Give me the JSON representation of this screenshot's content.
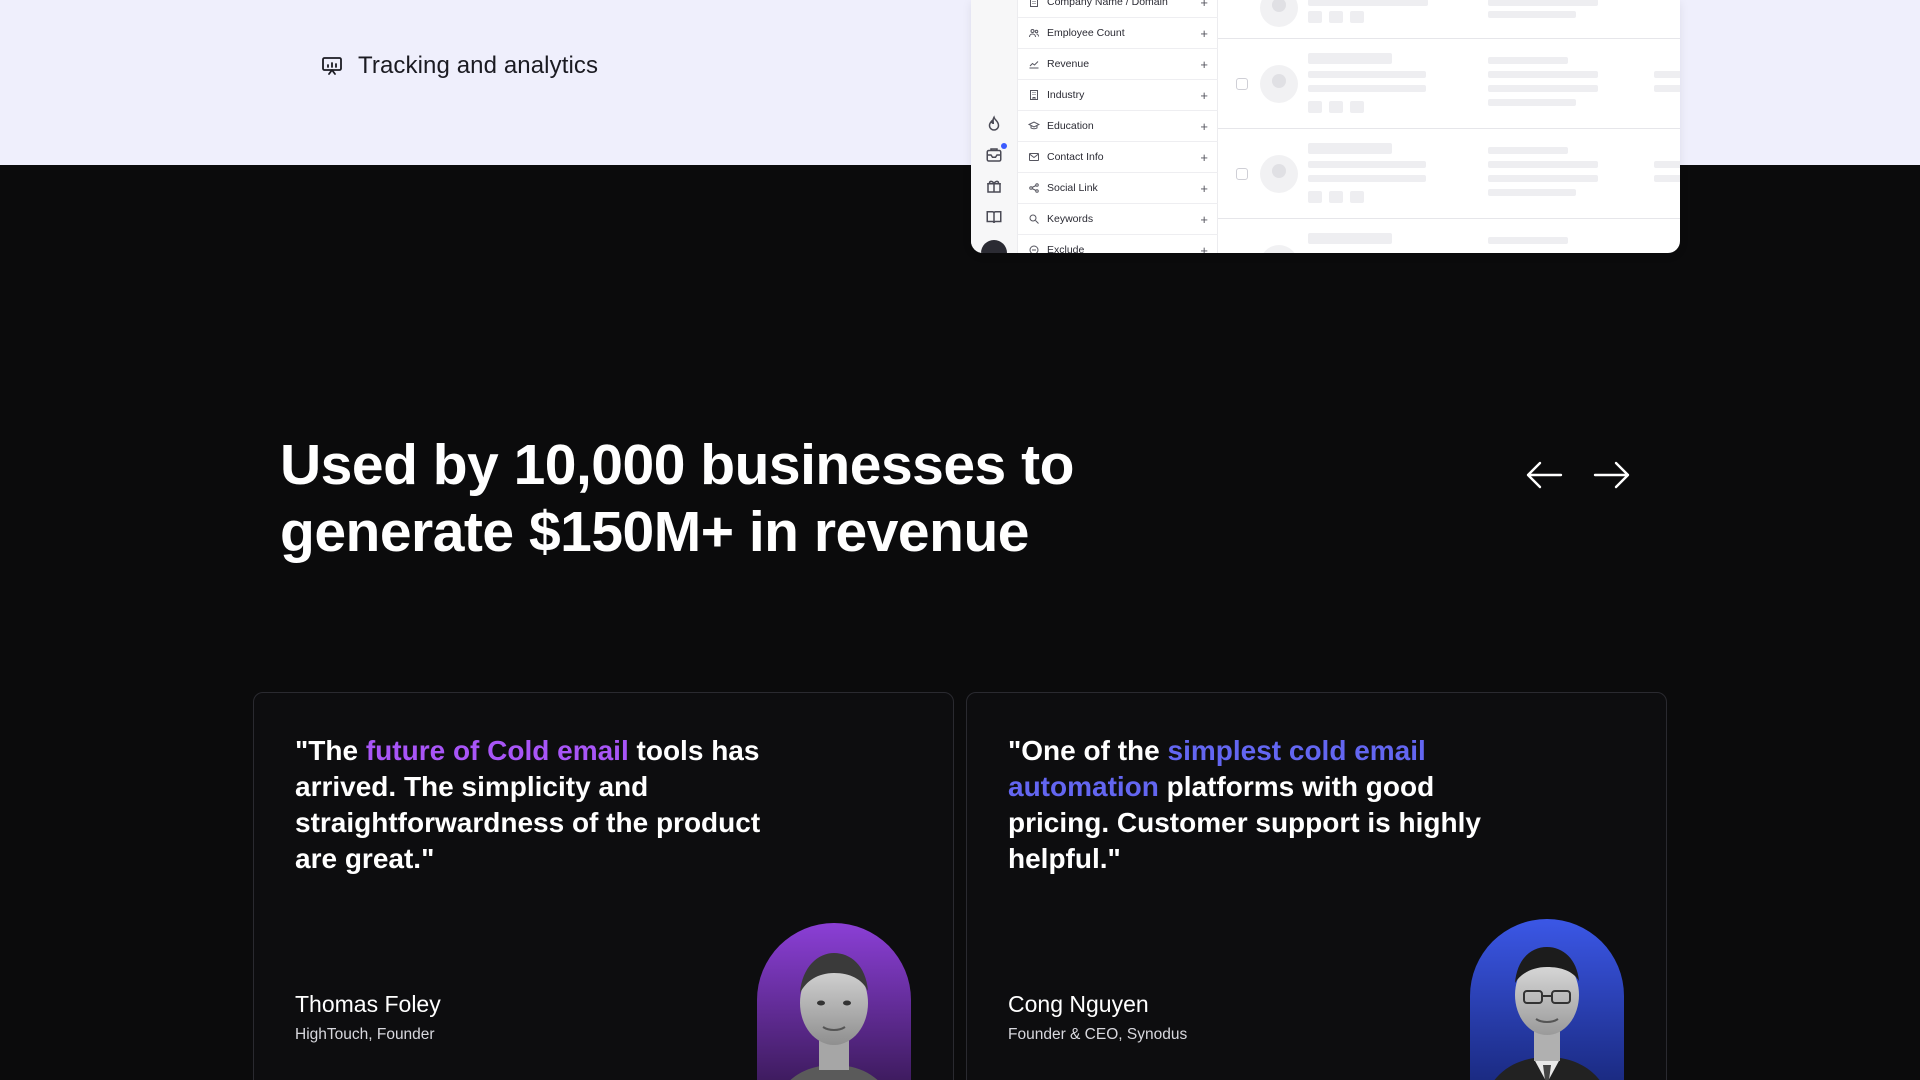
{
  "feature": {
    "label": "Tracking and analytics",
    "icon": "presentation-chart-icon"
  },
  "mock": {
    "filters": [
      {
        "label": "Company Name / Domain",
        "icon": "building-icon"
      },
      {
        "label": "Employee Count",
        "icon": "users-icon"
      },
      {
        "label": "Revenue",
        "icon": "trend-icon"
      },
      {
        "label": "Industry",
        "icon": "building-icon"
      },
      {
        "label": "Education",
        "icon": "graduation-cap-icon"
      },
      {
        "label": "Contact Info",
        "icon": "mail-icon"
      },
      {
        "label": "Social Link",
        "icon": "share-icon"
      },
      {
        "label": "Keywords",
        "icon": "search-icon"
      },
      {
        "label": "Exclude",
        "icon": "minus-circle-icon"
      }
    ],
    "plus": "+"
  },
  "headline": {
    "line1": "Used by 10,000 businesses to",
    "line2": "generate $150M+ in revenue"
  },
  "testimonials": [
    {
      "quote_pre": "\"The ",
      "quote_highlight": "future of Cold email",
      "quote_post": " tools has arrived. The simplicity and straightforwardness of the product are great.\"",
      "author": "Thomas Foley",
      "role": "HighTouch, Founder",
      "highlight_color": "#a855f7"
    },
    {
      "quote_pre": "\"One of the ",
      "quote_highlight": "simplest cold email automation",
      "quote_post": " platforms with good pricing. Customer support is highly helpful.\"",
      "author": "Cong Nguyen",
      "role": "Founder & CEO, Synodus",
      "highlight_color": "#6366f1"
    }
  ],
  "colors": {
    "background": "#0b0b0c",
    "top_band": "#efeffc",
    "accent_purple": "#a855f7",
    "accent_blue": "#6366f1"
  }
}
